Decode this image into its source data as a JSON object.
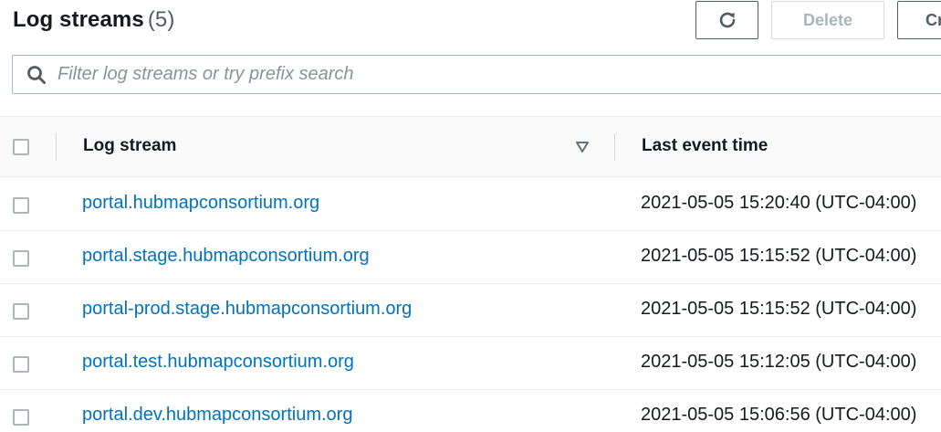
{
  "header": {
    "title": "Log streams",
    "count": "(5)",
    "refresh_icon": "refresh-icon",
    "delete_label": "Delete",
    "create_label_visible": "Cr"
  },
  "search": {
    "placeholder": "Filter log streams or try prefix search",
    "value": "",
    "icon": "search-icon"
  },
  "table": {
    "columns": [
      {
        "label": "Log stream",
        "sort_icon": "sort-descending-icon"
      },
      {
        "label": "Last event time"
      }
    ],
    "rows": [
      {
        "stream": "portal.hubmapconsortium.org",
        "last_event": "2021-05-05 15:20:40 (UTC-04:00)"
      },
      {
        "stream": "portal.stage.hubmapconsortium.org",
        "last_event": "2021-05-05 15:15:52 (UTC-04:00)"
      },
      {
        "stream": "portal-prod.stage.hubmapconsortium.org",
        "last_event": "2021-05-05 15:15:52 (UTC-04:00)"
      },
      {
        "stream": "portal.test.hubmapconsortium.org",
        "last_event": "2021-05-05 15:12:05 (UTC-04:00)"
      },
      {
        "stream": "portal.dev.hubmapconsortium.org",
        "last_event": "2021-05-05 15:06:56 (UTC-04:00)"
      }
    ]
  },
  "colors": {
    "link": "#0073bb",
    "text": "#16191f",
    "muted": "#879596",
    "border": "#aab7b8",
    "disabled": "#aab7b8"
  }
}
